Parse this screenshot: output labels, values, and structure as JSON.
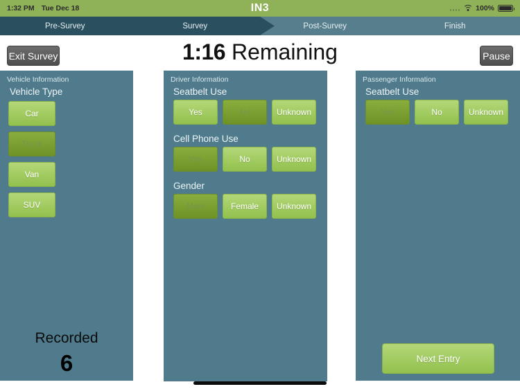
{
  "status_bar": {
    "time": "1:32 PM",
    "date": "Tue Dec 18",
    "app_title": "IN3",
    "battery_percent": "100%",
    "wifi_icon": "wifi-icon",
    "signal_icon": "signal-dots-icon",
    "battery_icon": "battery-full-icon"
  },
  "nav": {
    "steps": [
      {
        "label": "Pre-Survey",
        "state": "done"
      },
      {
        "label": "Survey",
        "state": "done"
      },
      {
        "label": "Post-Survey",
        "state": "upcoming"
      },
      {
        "label": "Finish",
        "state": "upcoming"
      }
    ]
  },
  "header": {
    "exit_label": "Exit Survey",
    "pause_label": "Pause",
    "timer_value": "1:16",
    "timer_label": "Remaining"
  },
  "vehicle_panel": {
    "panel_title": "Vehicle Information",
    "group_label": "Vehicle Type",
    "options": [
      {
        "label": "Car",
        "selected": false
      },
      {
        "label": "Truck",
        "selected": true
      },
      {
        "label": "Van",
        "selected": false
      },
      {
        "label": "SUV",
        "selected": false
      }
    ],
    "recorded_label": "Recorded",
    "recorded_value": "6"
  },
  "driver_panel": {
    "panel_title": "Driver Information",
    "groups": [
      {
        "label": "Seatbelt Use",
        "options": [
          {
            "label": "Yes",
            "selected": false
          },
          {
            "label": "No",
            "selected": true
          },
          {
            "label": "Unknown",
            "selected": false
          }
        ]
      },
      {
        "label": "Cell Phone Use",
        "options": [
          {
            "label": "Yes",
            "selected": true
          },
          {
            "label": "No",
            "selected": false
          },
          {
            "label": "Unknown",
            "selected": false
          }
        ]
      },
      {
        "label": "Gender",
        "options": [
          {
            "label": "Male",
            "selected": true
          },
          {
            "label": "Female",
            "selected": false
          },
          {
            "label": "Unknown",
            "selected": false
          }
        ]
      }
    ]
  },
  "passenger_panel": {
    "panel_title": "Passenger Information",
    "groups": [
      {
        "label": "Seatbelt Use",
        "options": [
          {
            "label": "Yes",
            "selected": true
          },
          {
            "label": "No",
            "selected": false
          },
          {
            "label": "Unknown",
            "selected": false
          }
        ]
      }
    ],
    "next_entry_label": "Next Entry"
  },
  "colors": {
    "status_bar_green": "#8fb158",
    "nav_done": "#2a5060",
    "nav_upcoming": "#577e8c",
    "panel_blue": "#4f7b8c",
    "button_green": "#92c14d",
    "button_selected_green": "#6f9227"
  }
}
